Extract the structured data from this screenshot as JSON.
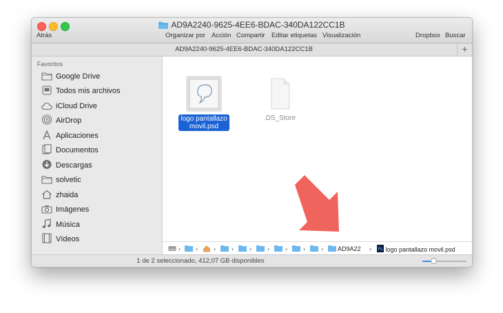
{
  "window": {
    "title": "AD9A2240-9625-4EE6-BDAC-340DA122CC1B",
    "tab_title": "AD9A2240-9625-4EE6-BDAC-340DA122CC1B",
    "tab_add": "+"
  },
  "toolbar": {
    "back": "Atrás",
    "organize": "Organizar por",
    "action": "Acción",
    "share": "Compartir",
    "edit_tags": "Editar etiquetas",
    "view": "Visualización",
    "dropbox": "Dropbox",
    "search": "Buscar"
  },
  "sidebar": {
    "header": "Favoritos",
    "items": [
      {
        "label": "Google Drive",
        "icon": "folder-icon"
      },
      {
        "label": "Todos mis archivos",
        "icon": "all-files-icon"
      },
      {
        "label": "iCloud Drive",
        "icon": "cloud-icon"
      },
      {
        "label": "AirDrop",
        "icon": "airdrop-icon"
      },
      {
        "label": "Aplicaciones",
        "icon": "applications-icon"
      },
      {
        "label": "Documentos",
        "icon": "documents-icon"
      },
      {
        "label": "Descargas",
        "icon": "downloads-icon"
      },
      {
        "label": "solvetic",
        "icon": "folder-icon"
      },
      {
        "label": "zhaida",
        "icon": "home-icon"
      },
      {
        "label": "Imágenes",
        "icon": "camera-icon"
      },
      {
        "label": "Música",
        "icon": "music-icon"
      },
      {
        "label": "Vídeos",
        "icon": "film-icon"
      }
    ]
  },
  "files": [
    {
      "name_line1": "logo pantallazo",
      "name_line2": "movil.psd",
      "selected": true
    },
    {
      "name_line1": ".DS_Store",
      "name_line2": "",
      "selected": false
    }
  ],
  "pathbar": {
    "segments": [
      "",
      "",
      "",
      "",
      "",
      "",
      "",
      "",
      ""
    ],
    "current_folder": "AD9A22",
    "file": "logo pantallazo movil.psd"
  },
  "status": {
    "text": "1 de 2 seleccionado, 412,07 GB disponibles",
    "zoom_fraction": 0.25
  },
  "colors": {
    "selection": "#1b63d4",
    "folder": "#6cb8ef",
    "arrow": "#f0645e"
  }
}
